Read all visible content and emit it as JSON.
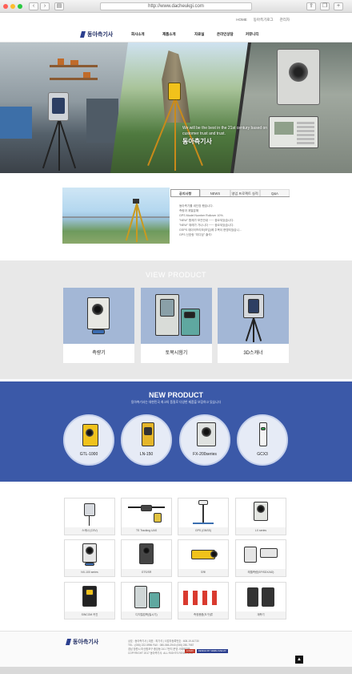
{
  "browser": {
    "url": "http://www.dacheukgi.com",
    "dot_colors": [
      "#ff5f57",
      "#ffbd2e",
      "#28c940"
    ]
  },
  "util": {
    "items": [
      "HOME",
      "동아측기로그",
      "관리자"
    ]
  },
  "nav": {
    "logo_text": "동아측기사",
    "menu": [
      "회사소개",
      "제품소개",
      "자료실",
      "온라인상담",
      "커뮤니티"
    ]
  },
  "hero": {
    "tagline": "We will be the best in the 21st century based on customer trust and trust.",
    "brand": "동아측기사"
  },
  "notice": {
    "tabs": [
      "공지사항",
      "NEWS",
      "영업 프로젝트 실적",
      "Q&A"
    ],
    "items": [
      "동아측기를 새단장 했습니다.",
      "측량과 계열분해",
      "GPS Model Number Rollover 10%.",
      "\"NEW\" 함께가 보관안내 ~~~ 중요되었습니다.",
      "\"NEW\" 재래가 가나니다 ~~~ 중요되었습니다.",
      "GSPS 데이터프리모(보임)에 주목이 현명되었습니...",
      "GPS 신호랑 \"미디엄\" 출석!"
    ]
  },
  "view_product": {
    "title": "VIEW PRODUCT",
    "cards": [
      "측량기",
      "토목시험기",
      "3D스캐너"
    ]
  },
  "new_product": {
    "title": "NEW PRODUCT",
    "subtitle": "동아측기사는 대한민국 최고의 품질로 다양한 제품을 보장하고 있습니다",
    "items": [
      "GTL-1000",
      "LN-150",
      "FX-200series",
      "GCX3"
    ]
  },
  "grid": {
    "labels": [
      "스캐너 (CSV)",
      "TS Tracking UAS",
      "GPS (GNSS)",
      "LX series",
      "NX-100 series",
      "GTS/SR",
      "오토",
      "레벨측량(SP/SDX/AD)",
      "SINCOM 커진",
      "디지털압축(밀시기)",
      "측정용품(도구)류",
      "계측기"
    ]
  },
  "footer": {
    "logo_text": "동아측기사",
    "lines": [
      "상호 : 동아측기사 | 대표 : 최기석 | 사업자등록번호 : 608-19-61730",
      "TEL : (055) 222-5996 FAX : 080-565-2940 (055) 280-7987",
      "경남 창원시 마산합포구 중앙동 241 7번지 운영 사회화대표",
      "COPYRIGHT 2017 동아측기사. ALL RIGHTS RESERVED"
    ],
    "badges": [
      "LOGIN",
      "DESIGN BY WEBLOVECAT"
    ],
    "badge_colors": [
      "#c0392b",
      "#2b3f8f"
    ]
  },
  "top_button": "▲"
}
